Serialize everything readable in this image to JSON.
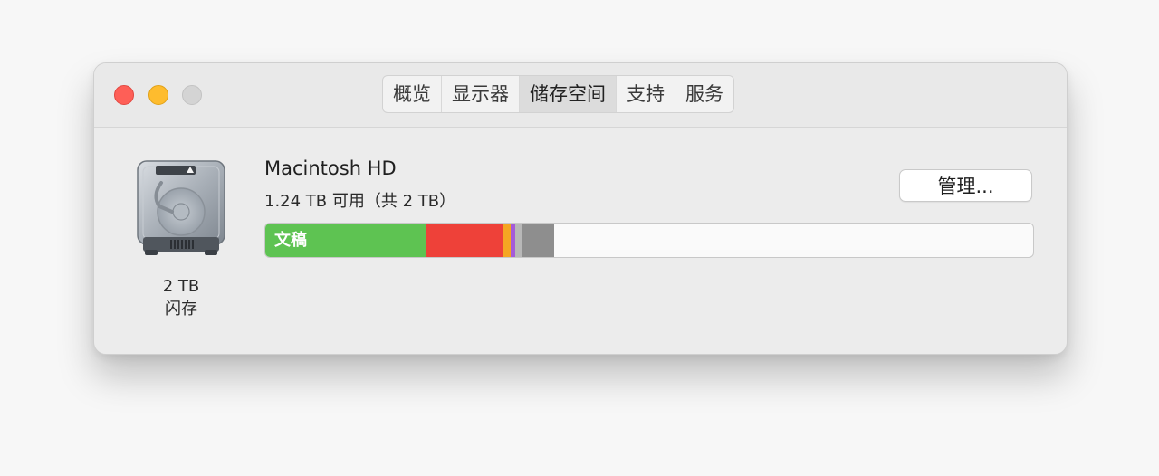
{
  "window": {
    "tabs": [
      {
        "label": "概览",
        "active": false
      },
      {
        "label": "显示器",
        "active": false
      },
      {
        "label": "储存空间",
        "active": true
      },
      {
        "label": "支持",
        "active": false
      },
      {
        "label": "服务",
        "active": false
      }
    ]
  },
  "disk": {
    "icon": "hard-drive-icon",
    "size_label": "2 TB",
    "type_label": "闪存",
    "name": "Macintosh HD",
    "usage": "1.24 TB 可用（共 2 TB）",
    "manage_label": "管理..."
  },
  "storage_bar": {
    "segments": [
      {
        "name": "documents",
        "label": "文稿",
        "fraction": 0.209,
        "color": "#5ec352"
      },
      {
        "name": "segment-red",
        "label": "",
        "fraction": 0.101,
        "color": "#ee4139"
      },
      {
        "name": "segment-orange",
        "label": "",
        "fraction": 0.0095,
        "color": "#f5a623"
      },
      {
        "name": "segment-purple",
        "label": "",
        "fraction": 0.0059,
        "color": "#a55bd9"
      },
      {
        "name": "segment-light-gray",
        "label": "",
        "fraction": 0.0083,
        "color": "#b8b8b8"
      },
      {
        "name": "segment-gray",
        "label": "",
        "fraction": 0.043,
        "color": "#8e8e8e"
      }
    ],
    "free_color": "#fafafa"
  },
  "colors": {
    "close": "#fe5f57",
    "minimize": "#febc2e",
    "zoom": "#d4d4d4"
  }
}
